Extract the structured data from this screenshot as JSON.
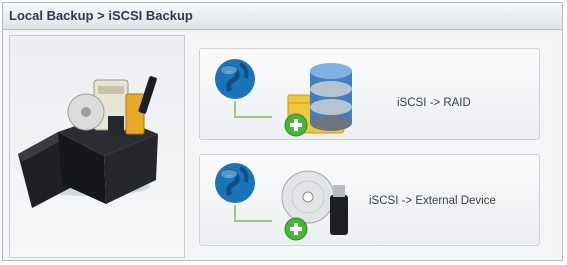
{
  "title": "Local Backup > iSCSI Backup",
  "options": [
    {
      "label": "iSCSI -> RAID",
      "icons": [
        "globe-icon",
        "database-icon",
        "folder-icon",
        "plus-icon"
      ]
    },
    {
      "label": "iSCSI -> External Device",
      "icons": [
        "globe-icon",
        "disc-icon",
        "usb-drive-icon",
        "plus-icon"
      ]
    }
  ],
  "sidebar": {
    "illustration": "backup-box-illustration"
  },
  "colors": {
    "accent_green": "#49b43a",
    "globe_blue": "#1b74b8",
    "title_text": "#2e3a4a"
  }
}
